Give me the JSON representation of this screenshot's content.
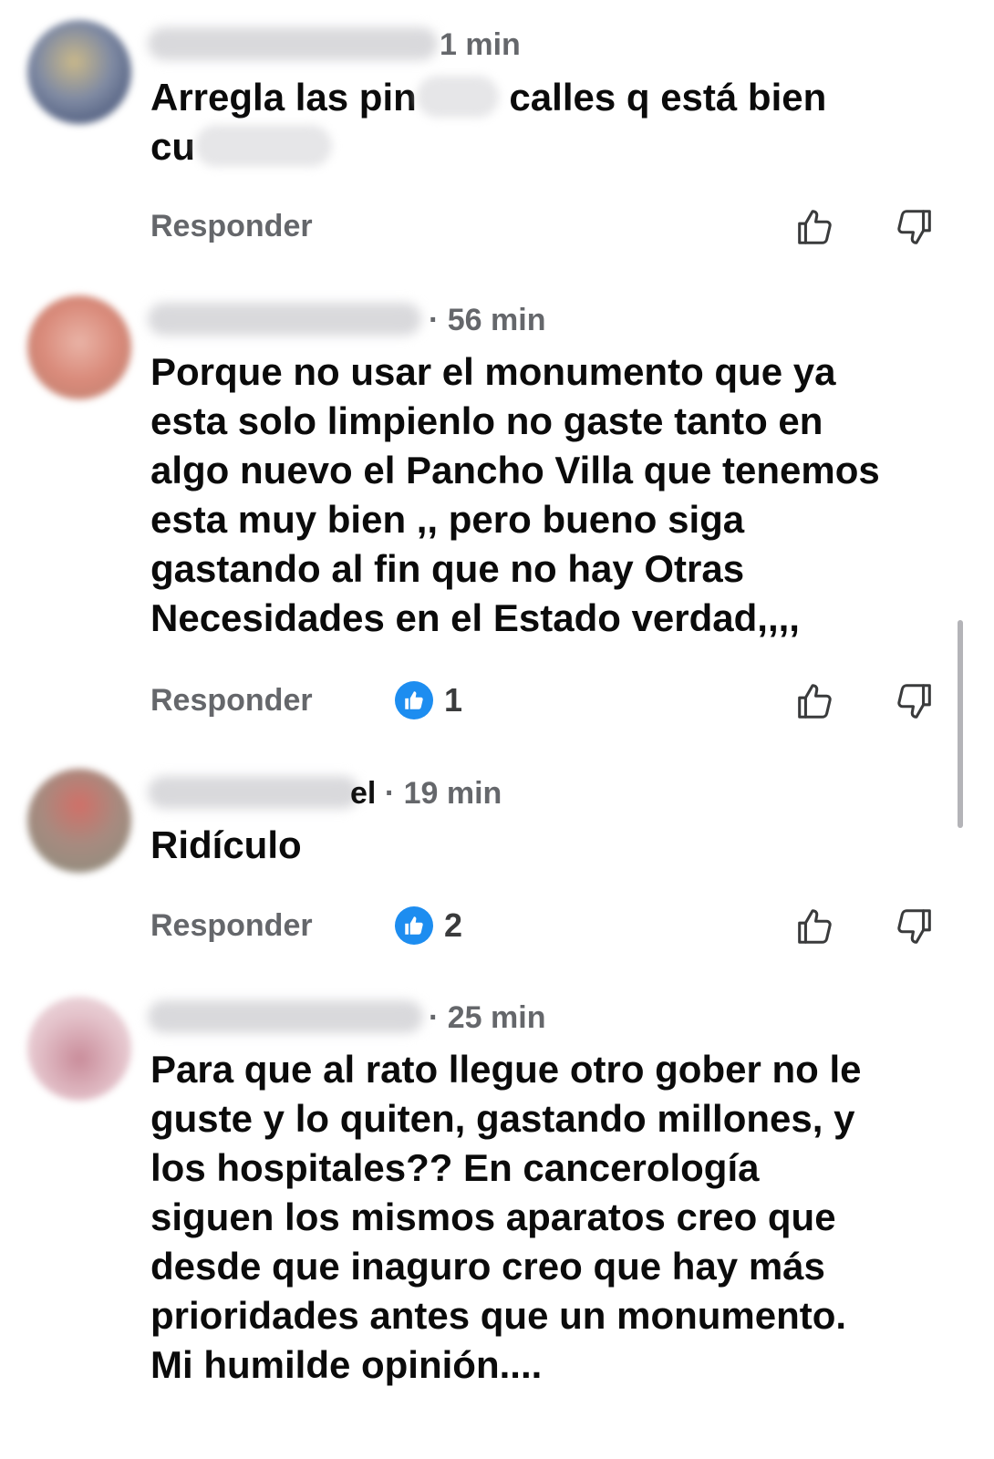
{
  "comments": [
    {
      "time": "1 min",
      "name_tail": "",
      "text_part1": "Arregla las pin",
      "text_part2": " calles q está bien\ncu",
      "text_part3": "",
      "reply_label": "Responder",
      "reaction_count": ""
    },
    {
      "time": "· 56 min",
      "name_tail": "",
      "text": "Porque no usar el monumento que ya\nesta solo limpienlo no gaste tanto en\nalgo nuevo el Pancho Villa que tenemos\nesta muy bien ,,  pero bueno siga\ngastando al fin que no hay Otras\nNecesidades en el Estado verdad,,,,",
      "reply_label": "Responder",
      "reaction_count": "1"
    },
    {
      "time": "· 19 min",
      "name_tail": "el",
      "text": "Ridículo",
      "reply_label": "Responder",
      "reaction_count": "2"
    },
    {
      "time": "· 25 min",
      "name_tail": "",
      "text": "Para que al rato llegue otro gober no le\nguste y lo quiten, gastando millones, y\nlos hospitales?? En cancerología\nsiguen los mismos aparatos creo que\ndesde que inaguro creo que hay más\nprioridades antes que un monumento.\nMi humilde opinión....",
      "reply_label": "",
      "reaction_count": ""
    }
  ],
  "icons": {
    "like": "thumbs-up-icon",
    "dislike": "thumbs-down-icon",
    "reaction": "like-reaction-icon"
  },
  "colors": {
    "reaction_blue": "#1d8df0",
    "meta_gray": "#65676b"
  }
}
